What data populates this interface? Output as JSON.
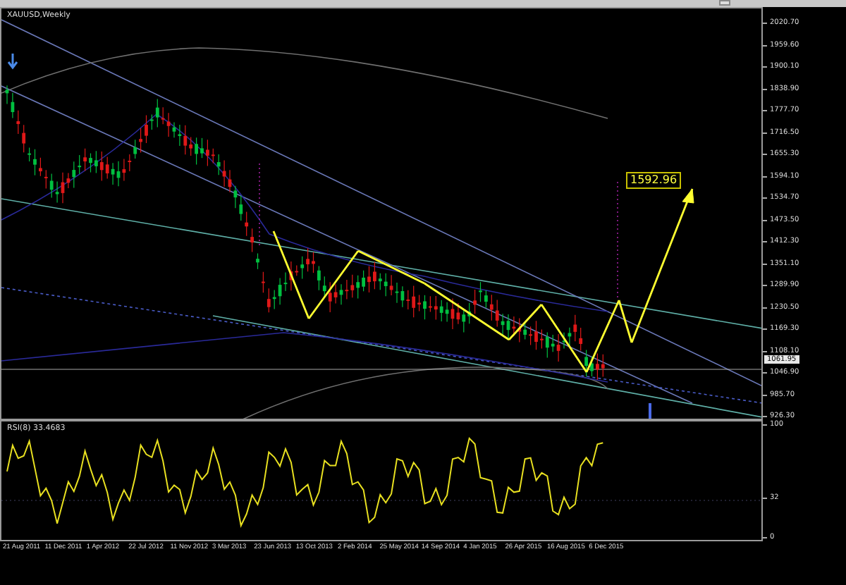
{
  "chart": {
    "title": "XAUUSD,Weekly",
    "current_price": "1061.95",
    "target_label": "1592.96"
  },
  "price_axis": [
    "2020.70",
    "1959.60",
    "1900.10",
    "1838.90",
    "1777.70",
    "1716.50",
    "1655.30",
    "1594.10",
    "1534.70",
    "1473.50",
    "1412.30",
    "1351.10",
    "1289.90",
    "1230.50",
    "1169.30",
    "1108.10",
    "1046.90",
    "985.70",
    "926.30"
  ],
  "rsi": {
    "label": "RSI(8) 33.4683",
    "axis": [
      "100",
      "32",
      "0"
    ]
  },
  "time_axis": [
    "21 Aug 2011",
    "11 Dec 2011",
    "1 Apr 2012",
    "22 Jul 2012",
    "11 Nov 2012",
    "3 Mar 2013",
    "23 Jun 2013",
    "13 Oct 2013",
    "2 Feb 2014",
    "25 May 2014",
    "14 Sep 2014",
    "4 Jan 2015",
    "26 Apr 2015",
    "16 Aug 2015",
    "6 Dec 2015"
  ]
}
